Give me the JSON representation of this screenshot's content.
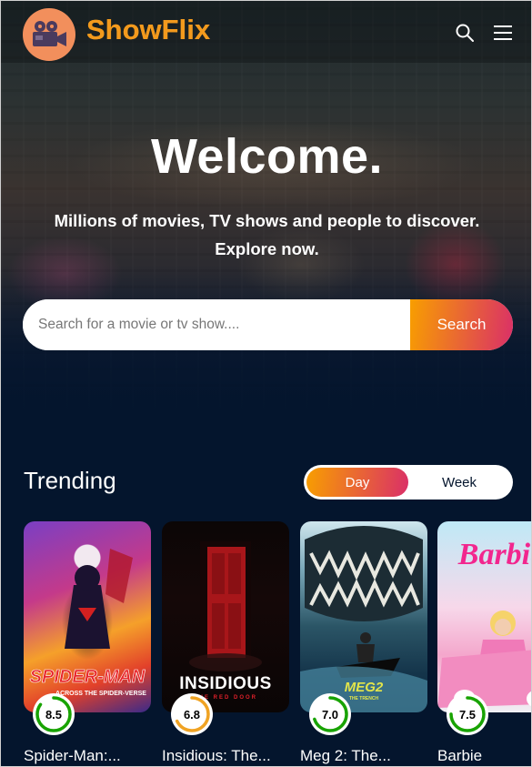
{
  "header": {
    "brand": "ShowFlix",
    "icons": [
      "search-icon",
      "menu-icon"
    ]
  },
  "hero": {
    "title": "Welcome.",
    "subtitle_line1": "Millions of movies, TV shows and people to discover.",
    "subtitle_line2": "Explore now.",
    "search_placeholder": "Search for a movie or tv show....",
    "search_button": "Search"
  },
  "trending": {
    "title": "Trending",
    "tabs": [
      "Day",
      "Week"
    ],
    "active_tab": "Day",
    "items": [
      {
        "title": "Spider-Man:...",
        "rating": "8.5",
        "rating_value": 8.5,
        "ring_color": "#18a300",
        "poster_text": "SPIDER-MAN",
        "poster_sub": "ACROSS THE SPIDER-VERSE"
      },
      {
        "title": "Insidious: The...",
        "rating": "6.8",
        "rating_value": 6.8,
        "ring_color": "#f0a323",
        "poster_text": "INSIDIOUS",
        "poster_sub": "THE RED DOOR"
      },
      {
        "title": "Meg 2: The...",
        "rating": "7.0",
        "rating_value": 7.0,
        "ring_color": "#18a300",
        "poster_text": "MEG2",
        "poster_sub": "THE TRENCH"
      },
      {
        "title": "Barbie",
        "rating": "7.5",
        "rating_value": 7.5,
        "ring_color": "#18a300",
        "poster_text": "Barbie",
        "poster_sub": ""
      }
    ]
  },
  "colors": {
    "background": "#04152d",
    "accent_orange": "#f89e00",
    "accent_pink": "#da2f68",
    "brand": "#f39a1d"
  }
}
